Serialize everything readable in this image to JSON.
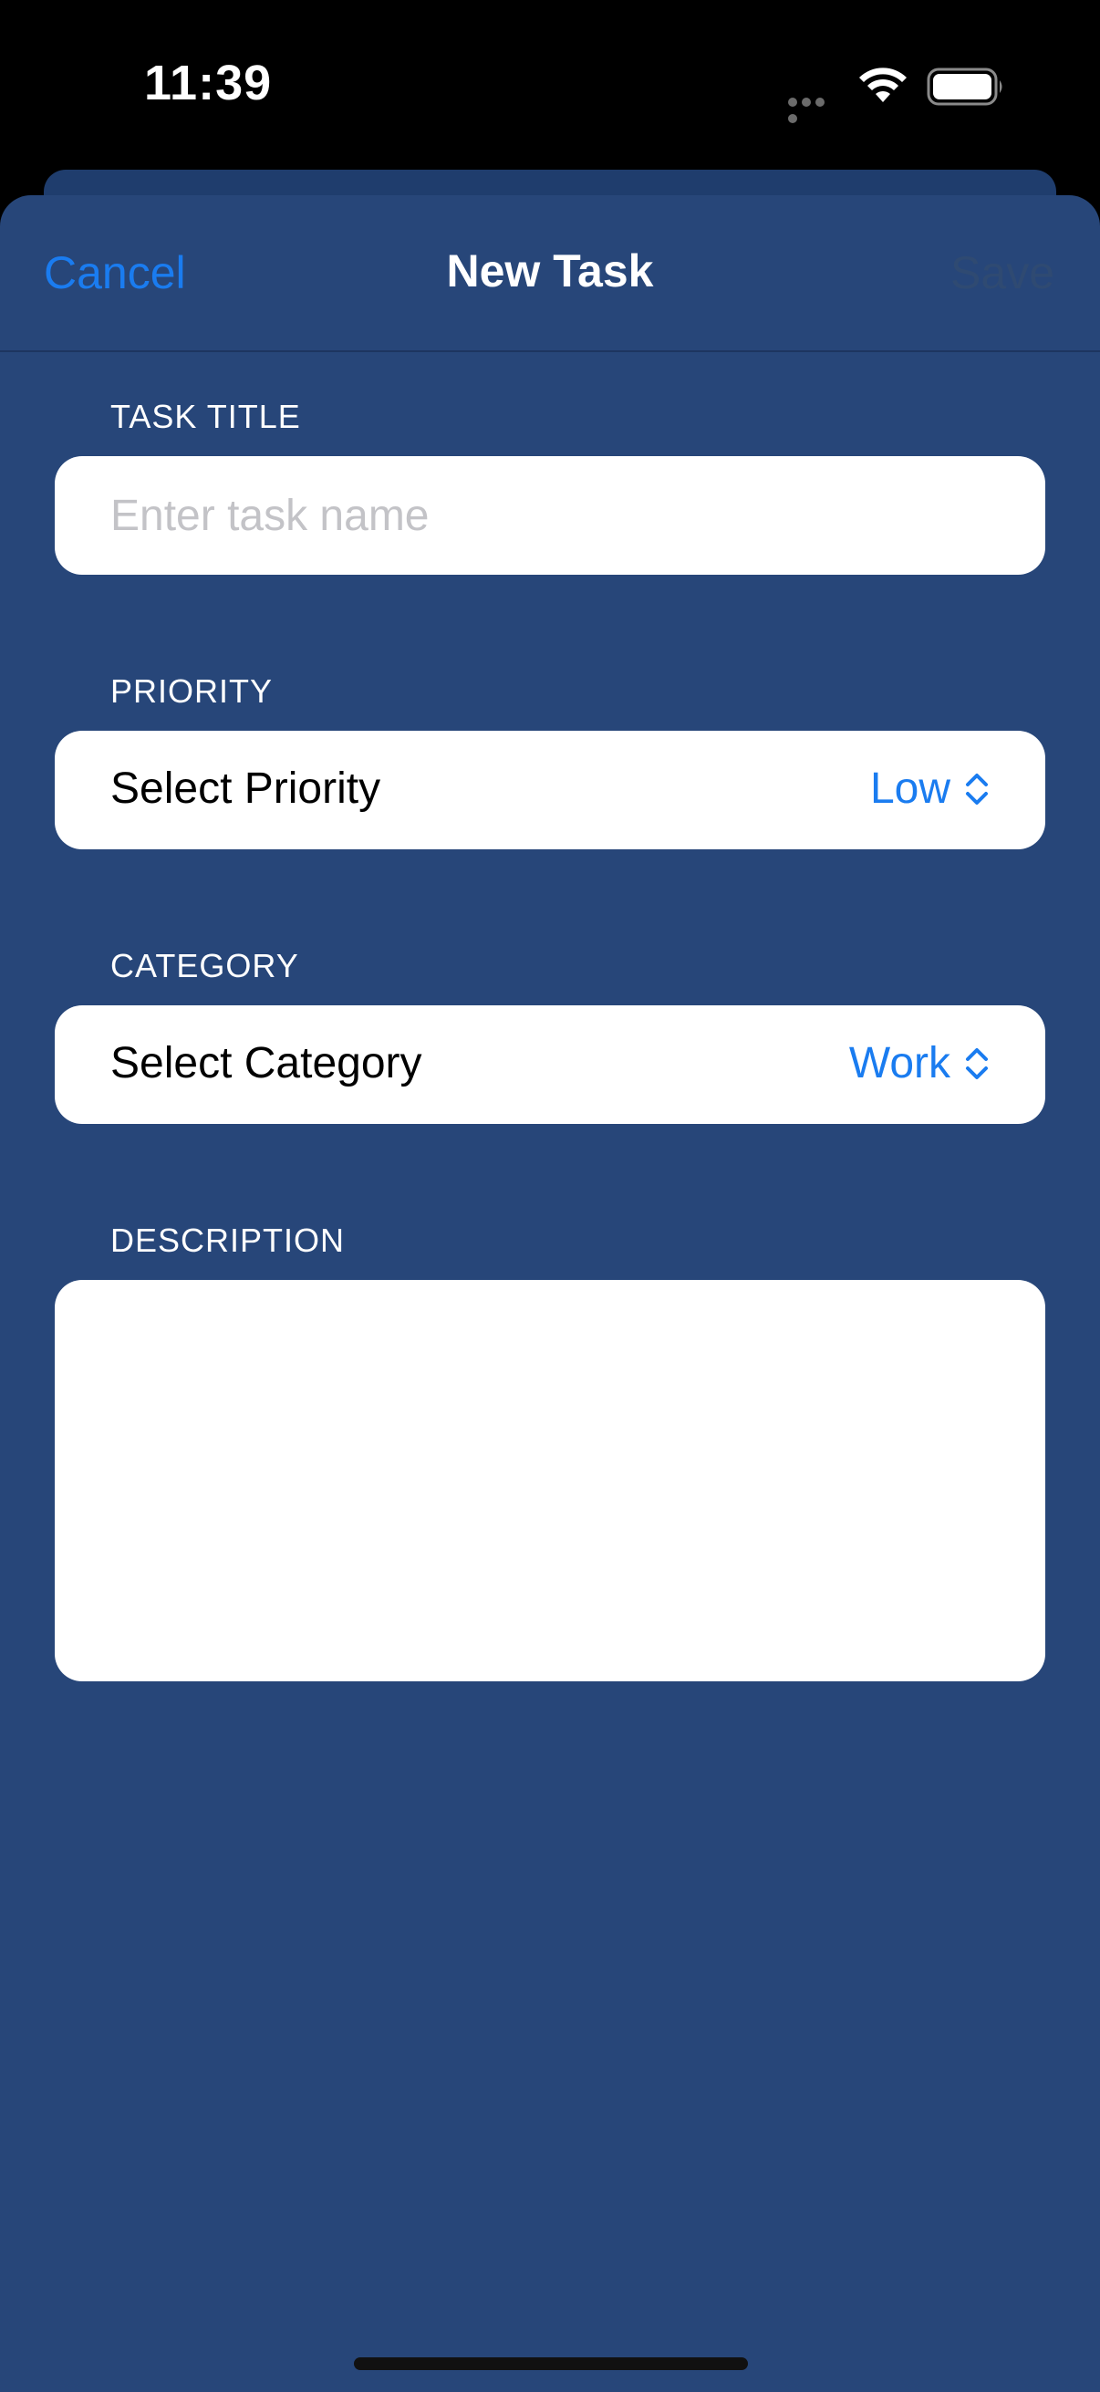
{
  "status_bar": {
    "time": "11:39"
  },
  "nav": {
    "cancel_label": "Cancel",
    "title": "New Task",
    "save_label": "Save"
  },
  "form": {
    "task_title": {
      "label": "TASK TITLE",
      "placeholder": "Enter task name",
      "value": ""
    },
    "priority": {
      "label": "PRIORITY",
      "row_label": "Select Priority",
      "selected": "Low"
    },
    "category": {
      "label": "CATEGORY",
      "row_label": "Select Category",
      "selected": "Work"
    },
    "description": {
      "label": "DESCRIPTION",
      "value": ""
    }
  },
  "colors": {
    "sheet_background": "#274679",
    "accent": "#1a7cf0",
    "field_background": "#ffffff"
  }
}
